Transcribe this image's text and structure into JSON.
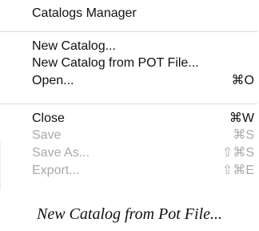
{
  "menu": {
    "header": "Catalogs Manager",
    "items": [
      {
        "label": "New Catalog...",
        "shortcut": "",
        "enabled": true
      },
      {
        "label": "New Catalog from POT File...",
        "shortcut": "",
        "enabled": true
      },
      {
        "label": "Open...",
        "shortcut": "⌘O",
        "enabled": true
      },
      {
        "label": "Close",
        "shortcut": "⌘W",
        "enabled": true
      },
      {
        "label": "Save",
        "shortcut": "⌘S",
        "enabled": false
      },
      {
        "label": "Save As...",
        "shortcut": "⇧⌘S",
        "enabled": false
      },
      {
        "label": "Export...",
        "shortcut": "⇧⌘E",
        "enabled": false
      }
    ]
  },
  "caption": "New Catalog from Pot File...",
  "colors": {
    "enabled_text": "#111111",
    "disabled_text": "#a9a9a9",
    "separator": "#dcdcdc",
    "background": "#ffffff"
  }
}
